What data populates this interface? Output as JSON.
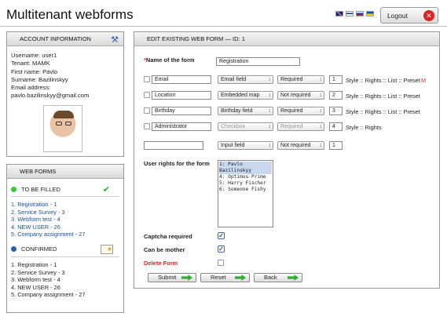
{
  "app_title": "Multitenant webforms",
  "logout_label": "Logout",
  "account": {
    "header": "ACCOUNT INFORMATION",
    "username": "Username: user1",
    "tenant": "Tenant: MAMK",
    "first": "First name: Pavlo",
    "surname": "Surname: Bazilinskyy",
    "email_label": "Email address:",
    "email": "pavlo.bazilinskyy@gmail.com"
  },
  "webforms": {
    "header": "WEB FORMS",
    "to_fill": "TO BE FILLED",
    "confirmed": "CONFIRMED",
    "to_fill_items": [
      "1. Registration - 1",
      "2. Service Survey - 3",
      "3. Webform test - 4",
      "4. NEW USER - 26",
      "5. Company assignment - 27"
    ],
    "confirmed_items": [
      "1. Registration - 1",
      "2. Service Survey - 3",
      "3. Webform test - 4",
      "4. NEW USER - 26",
      "5. Company assignment - 27"
    ]
  },
  "edit": {
    "header": "EDIT EXISTING WEB FORM — ID: 1",
    "name_label": "Name of the form",
    "name_value": "Registration",
    "rows": [
      {
        "name": "Email",
        "type": "Email field",
        "req": "Required",
        "order": "1",
        "links": "Style :: Rights :: List :: Preset",
        "extra": "M"
      },
      {
        "name": "Location",
        "type": "Embedded map",
        "req": "Not required",
        "order": "2",
        "links": "Style :: Rights :: List :: Preset",
        "extra": ""
      },
      {
        "name": "Birthday",
        "type": "Birthday field",
        "req": "Required",
        "order": "3",
        "links": "Style :: Rights :: List :: Preset",
        "extra": ""
      },
      {
        "name": "Administrator",
        "type": "Checkbox",
        "req": "Required",
        "order": "4",
        "links": "Style :: Rights",
        "extra": ""
      }
    ],
    "new_row": {
      "name": "",
      "type": "Input field",
      "req": "Not required",
      "order": "1"
    },
    "rights_label": "User rights for the form",
    "users": [
      "1: Pavlo Bazilinskyy",
      "4: Optimus Prime",
      "5: Harry Fischer",
      "6: Someone Fishy"
    ],
    "captcha": "Captcha required",
    "mother": "Can be mother",
    "delete": "Delete Form",
    "submit": "Submit",
    "reset": "Reset",
    "back": "Back"
  },
  "colors": {
    "link": "#1e4f86",
    "delete": "#d22222",
    "green_dot": "#3c3",
    "blue_dot": "#2a5fb5"
  }
}
